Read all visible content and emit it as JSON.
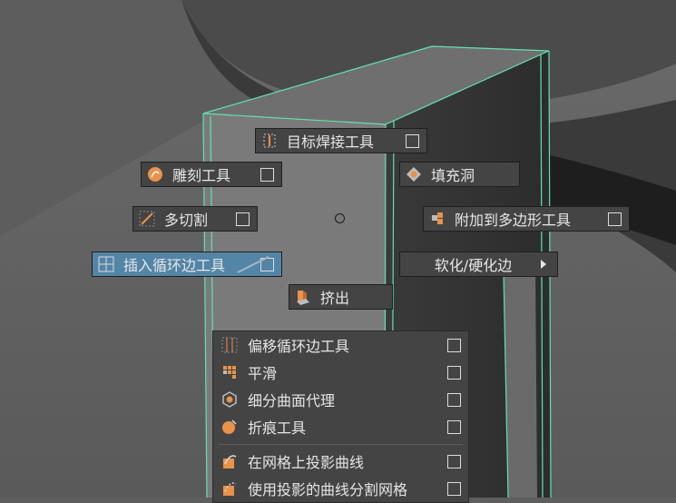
{
  "marking_menu": {
    "north": {
      "label": "目标焊接工具",
      "icon": "target-weld-icon"
    },
    "northwest": {
      "label": "雕刻工具",
      "icon": "sculpt-icon"
    },
    "northeast": {
      "label": "填充洞",
      "icon": "fill-hole-icon"
    },
    "west": {
      "label": "多切割",
      "icon": "multi-cut-icon"
    },
    "east": {
      "label": "附加到多边形工具",
      "icon": "append-polygon-icon"
    },
    "southwest": {
      "label": "插入循环边工具",
      "icon": "insert-edge-loop-icon",
      "highlighted": true
    },
    "southeast": {
      "label": "软化/硬化边",
      "icon": "submenu-arrow-icon"
    },
    "south": {
      "label": "挤出",
      "icon": "extrude-icon"
    }
  },
  "overflow_menu": {
    "items": [
      {
        "label": "偏移循环边工具",
        "icon": "offset-edge-loop-icon"
      },
      {
        "label": "平滑",
        "icon": "smooth-icon"
      },
      {
        "label": "细分曲面代理",
        "icon": "smooth-proxy-icon"
      },
      {
        "label": "折痕工具",
        "icon": "crease-icon"
      },
      {
        "label": "在网格上投影曲线",
        "icon": "project-curve-icon"
      },
      {
        "label": "使用投影的曲线分割网格",
        "icon": "split-mesh-curve-icon"
      }
    ]
  },
  "colors": {
    "menu_bg": "#444444",
    "highlight_bg": "#5285a6",
    "wire_highlight": "#5fe3b0",
    "icon_orange": "#e8924a",
    "text": "#e6e6e6"
  }
}
